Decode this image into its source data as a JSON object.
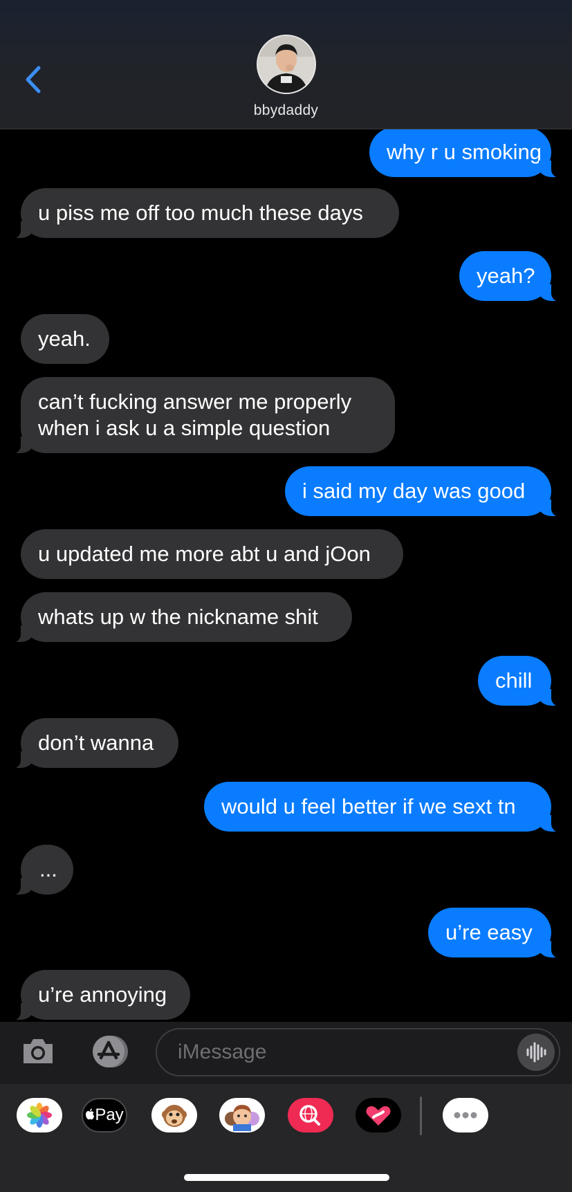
{
  "header": {
    "contact_name": "bbydaddy",
    "back_icon": "chevron-left-icon",
    "accent_color": "#3b8ef3"
  },
  "messages": [
    {
      "dir": "out",
      "text": "why r u smoking"
    },
    {
      "dir": "in",
      "text": "u piss me off too much these days"
    },
    {
      "dir": "out",
      "text": "yeah?"
    },
    {
      "dir": "in",
      "text": "yeah."
    },
    {
      "dir": "in",
      "text": "can’t fucking answer me properly\nwhen i ask u a simple question"
    },
    {
      "dir": "out",
      "text": "i said my day was good"
    },
    {
      "dir": "in",
      "text": "u updated me more abt u and jOon"
    },
    {
      "dir": "in",
      "text": "whats up w the nickname shit"
    },
    {
      "dir": "out",
      "text": "chill"
    },
    {
      "dir": "in",
      "text": "don’t wanna"
    },
    {
      "dir": "out",
      "text": "would u feel better if we sext tn"
    },
    {
      "dir": "in",
      "text": "..."
    },
    {
      "dir": "out",
      "text": "u’re easy"
    },
    {
      "dir": "in",
      "text": "u’re annoying"
    }
  ],
  "compose": {
    "placeholder": "iMessage",
    "camera_icon": "camera-icon",
    "apps_icon": "app-store-icon",
    "audio_icon": "waveform-icon"
  },
  "drawer": {
    "apps": [
      {
        "name": "photos-app-icon"
      },
      {
        "name": "apple-pay-app-icon",
        "label": "Pay"
      },
      {
        "name": "animoji-app-icon"
      },
      {
        "name": "memoji-app-icon"
      },
      {
        "name": "image-search-app-icon"
      },
      {
        "name": "digital-touch-app-icon"
      },
      {
        "name": "more-apps-icon"
      }
    ]
  },
  "colors": {
    "outgoing_bubble": "#0a7cff",
    "incoming_bubble": "#333335",
    "background": "#000000"
  }
}
